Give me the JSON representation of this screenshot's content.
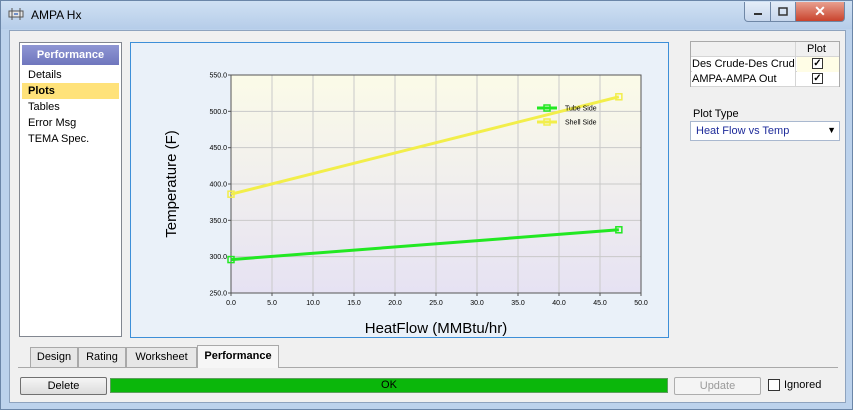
{
  "window": {
    "title": "AMPA Hx",
    "close_glyph": "✕"
  },
  "nav": {
    "header": "Performance",
    "items": [
      {
        "label": "Details",
        "active": false
      },
      {
        "label": "Plots",
        "active": true
      },
      {
        "label": "Tables",
        "active": false
      },
      {
        "label": "Error Msg",
        "active": false
      },
      {
        "label": "TEMA Spec.",
        "active": false
      }
    ]
  },
  "plot_grid": {
    "header": "Plot",
    "rows": [
      {
        "name": "Des Crude-Des Crud",
        "checked": true
      },
      {
        "name": "AMPA-AMPA Out",
        "checked": true
      }
    ]
  },
  "plot_type": {
    "label": "Plot Type",
    "value": "Heat Flow vs Temp"
  },
  "tabs": [
    "Design",
    "Rating",
    "Worksheet",
    "Performance"
  ],
  "active_tab": "Performance",
  "buttons": {
    "delete": "Delete",
    "update": "Update"
  },
  "status": {
    "text": "OK",
    "color": "#0bb70b"
  },
  "ignored_label": "Ignored",
  "chart_data": {
    "type": "line",
    "xlabel": "HeatFlow (MMBtu/hr)",
    "ylabel": "Temperature (F)",
    "xlim": [
      0,
      50
    ],
    "ylim": [
      250,
      550
    ],
    "xticks": [
      "0.0",
      "5.0",
      "10.0",
      "15.0",
      "20.0",
      "25.0",
      "30.0",
      "35.0",
      "40.0",
      "45.0",
      "50.0"
    ],
    "yticks": [
      "250.0",
      "300.0",
      "350.0",
      "400.0",
      "450.0",
      "500.0",
      "550.0"
    ],
    "series": [
      {
        "name": "Tube Side",
        "color": "#22e822",
        "x": [
          0,
          47.3
        ],
        "y": [
          296,
          337
        ]
      },
      {
        "name": "Shell Side",
        "color": "#f2ee4a",
        "x": [
          0,
          47.3
        ],
        "y": [
          386,
          520
        ]
      }
    ],
    "legend": "top-right",
    "grid": true
  }
}
